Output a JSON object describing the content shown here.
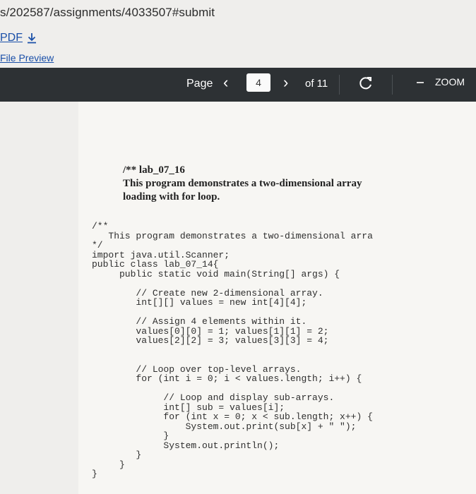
{
  "address_bar": {
    "url_fragment": "s/202587/assignments/4033507#submit"
  },
  "links": {
    "pdf_label": "PDF",
    "download_icon": "download-arrow-icon",
    "file_preview_label": "File Preview"
  },
  "toolbar": {
    "page_label": "Page",
    "prev_icon": "‹",
    "current_page": "4",
    "next_icon": "›",
    "total_pages": "of 11",
    "reload_icon": "reload-icon",
    "zoom_label": "ZOOM"
  },
  "document": {
    "description_lines": [
      "/** lab_07_16",
      "This program demonstrates a two-dimensional array",
      "loading with for loop."
    ],
    "code_lines": [
      "/**",
      "   This program demonstrates a two-dimensional arra",
      "*/",
      "import java.util.Scanner;",
      "public class lab_07_14{",
      "     public static void main(String[] args) {",
      "",
      "        // Create new 2-dimensional array.",
      "        int[][] values = new int[4][4];",
      "",
      "        // Assign 4 elements within it.",
      "        values[0][0] = 1; values[1][1] = 2;",
      "        values[2][2] = 3; values[3][3] = 4;",
      "",
      "",
      "        // Loop over top-level arrays.",
      "        for (int i = 0; i < values.length; i++) {",
      "",
      "             // Loop and display sub-arrays.",
      "             int[] sub = values[i];",
      "             for (int x = 0; x < sub.length; x++) {",
      "                 System.out.print(sub[x] + \" \");",
      "             }",
      "             System.out.println();",
      "        }",
      "     }",
      "}"
    ]
  }
}
